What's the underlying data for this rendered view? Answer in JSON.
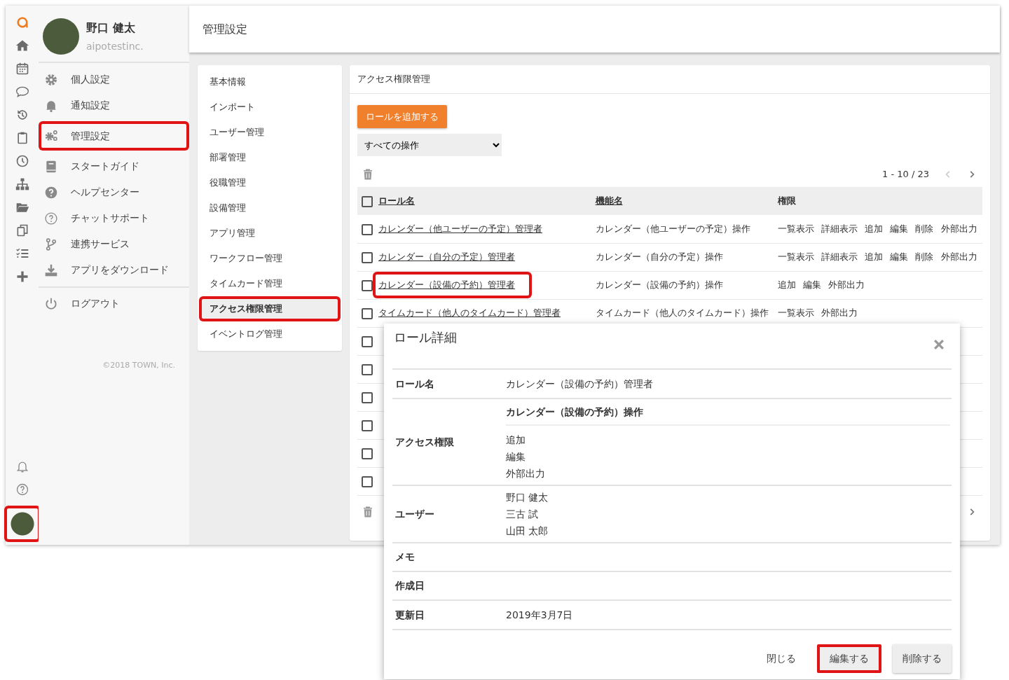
{
  "profile": {
    "name": "野口 健太",
    "org": "aipotestinc."
  },
  "rail": {
    "avatar_highlighted": true
  },
  "menu": [
    {
      "label": "個人設定",
      "highlighted": false
    },
    {
      "label": "通知設定",
      "highlighted": false
    },
    {
      "label": "管理設定",
      "highlighted": true
    },
    {
      "label": "スタートガイド",
      "highlighted": false
    },
    {
      "label": "ヘルプセンター",
      "highlighted": false
    },
    {
      "label": "チャットサポート",
      "highlighted": false
    },
    {
      "label": "連携サービス",
      "highlighted": false
    },
    {
      "label": "アプリをダウンロード",
      "highlighted": false
    }
  ],
  "logout": "ログアウト",
  "copyright": "©2018 TOWN, Inc.",
  "header": {
    "title": "管理設定"
  },
  "subnav": [
    {
      "label": "基本情報",
      "selected": false,
      "highlighted": false
    },
    {
      "label": "インポート",
      "selected": false,
      "highlighted": false
    },
    {
      "label": "ユーザー管理",
      "selected": false,
      "highlighted": false
    },
    {
      "label": "部署管理",
      "selected": false,
      "highlighted": false
    },
    {
      "label": "役職管理",
      "selected": false,
      "highlighted": false
    },
    {
      "label": "設備管理",
      "selected": false,
      "highlighted": false
    },
    {
      "label": "アプリ管理",
      "selected": false,
      "highlighted": false
    },
    {
      "label": "ワークフロー管理",
      "selected": false,
      "highlighted": false
    },
    {
      "label": "タイムカード管理",
      "selected": false,
      "highlighted": false
    },
    {
      "label": "アクセス権限管理",
      "selected": true,
      "highlighted": true
    },
    {
      "label": "イベントログ管理",
      "selected": false,
      "highlighted": false
    }
  ],
  "panel": {
    "title": "アクセス権限管理",
    "add_button": "ロールを追加する",
    "filter": "すべての操作",
    "all_checked": false,
    "pager": {
      "text": "1 - 10 / 23",
      "prev_disabled": true,
      "next_disabled": false
    },
    "columns": [
      "ロール名",
      "機能名",
      "権限"
    ],
    "rows": [
      {
        "checked": false,
        "highlighted": false,
        "role": "カレンダー（他ユーザーの予定）管理者",
        "function": "カレンダー（他ユーザーの予定）操作",
        "permissions": "一覧表示 詳細表示 追加 編集 削除 外部出力"
      },
      {
        "checked": false,
        "highlighted": false,
        "role": "カレンダー（自分の予定）管理者",
        "function": "カレンダー（自分の予定）操作",
        "permissions": "一覧表示 詳細表示 追加 編集 削除 外部出力"
      },
      {
        "checked": false,
        "highlighted": true,
        "role": "カレンダー（設備の予約）管理者",
        "function": "カレンダー（設備の予約）操作",
        "permissions": "追加 編集 外部出力"
      },
      {
        "checked": false,
        "highlighted": false,
        "role": "タイムカード（他人のタイムカード）管理者",
        "function": "タイムカード（他人のタイムカード）操作",
        "permissions": "一覧表示 外部出力"
      },
      {
        "checked": false,
        "highlighted": false
      },
      {
        "checked": false,
        "highlighted": false
      },
      {
        "checked": false,
        "highlighted": false
      },
      {
        "checked": false,
        "highlighted": false
      },
      {
        "checked": false,
        "highlighted": false
      },
      {
        "checked": false,
        "highlighted": false
      }
    ]
  },
  "dialog": {
    "title": "ロール詳細",
    "fields": [
      {
        "kind": "text",
        "label": "ロール名",
        "value": "カレンダー（設備の予約）管理者"
      },
      {
        "kind": "access",
        "label": "アクセス権限",
        "function": "カレンダー（設備の予約）操作",
        "values": [
          "追加",
          "編集",
          "外部出力"
        ]
      },
      {
        "kind": "list",
        "label": "ユーザー",
        "values": [
          "野口 健太",
          "三古 試",
          "山田 太郎"
        ]
      },
      {
        "kind": "text",
        "label": "メモ"
      },
      {
        "kind": "text",
        "label": "作成日"
      },
      {
        "kind": "text",
        "label": "更新日",
        "value": "2019年3月7日"
      }
    ],
    "buttons": [
      {
        "label": "閉じる",
        "kind": "flat",
        "highlighted": false
      },
      {
        "label": "編集する",
        "kind": "raised",
        "highlighted": true
      },
      {
        "label": "削除する",
        "kind": "raised",
        "highlighted": false
      }
    ]
  }
}
